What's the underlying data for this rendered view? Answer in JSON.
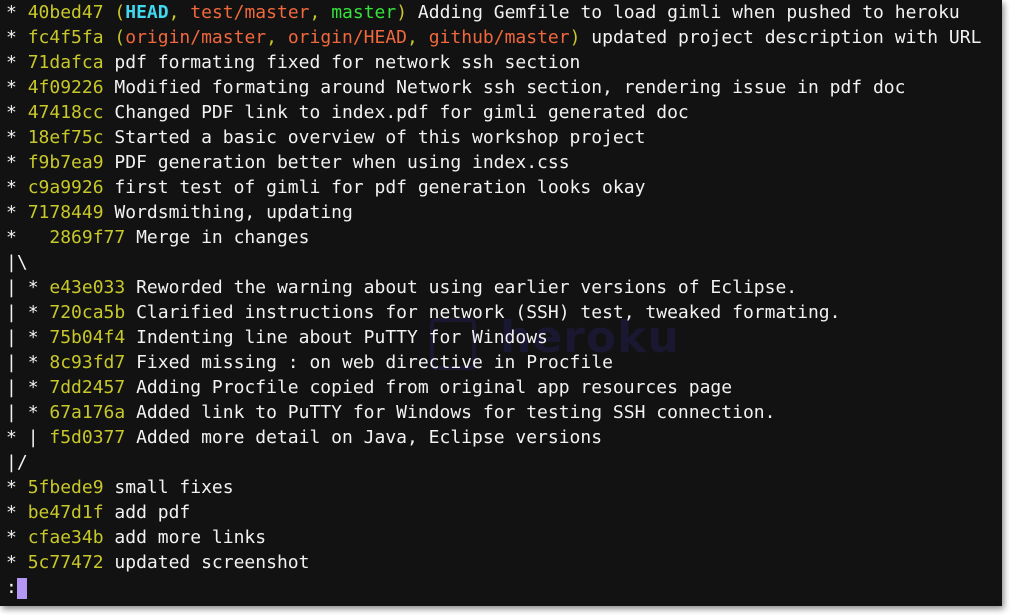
{
  "colors": {
    "background": "#121212",
    "hash": "#c8c82a",
    "head_ref": "#3fd8ef",
    "remote_ref": "#f0683c",
    "local_ref": "#34e23a",
    "branch_graph": "#2fd25a",
    "cursor": "#b497f5"
  },
  "watermark": {
    "text": "heroku"
  },
  "commits": [
    {
      "graph": "* ",
      "hash": "40bed47",
      "refs": [
        "HEAD",
        "test/master",
        "master"
      ],
      "message": "Adding Gemfile to load gimli when pushed to heroku"
    },
    {
      "graph": "* ",
      "hash": "fc4f5fa",
      "refs": [
        "origin/master",
        "origin/HEAD",
        "github/master"
      ],
      "message": "updated project description with URL"
    },
    {
      "graph": "* ",
      "hash": "71dafca",
      "message": "pdf formating fixed for network ssh section"
    },
    {
      "graph": "* ",
      "hash": "4f09226",
      "message": "Modified formating around Network ssh section, rendering issue in pdf doc"
    },
    {
      "graph": "* ",
      "hash": "47418cc",
      "message": "Changed PDF link to index.pdf for gimli generated doc"
    },
    {
      "graph": "* ",
      "hash": "18ef75c",
      "message": "Started a basic overview of this workshop project"
    },
    {
      "graph": "* ",
      "hash": "f9b7ea9",
      "message": "PDF generation better when using index.css"
    },
    {
      "graph": "* ",
      "hash": "c9a9926",
      "message": "first test of gimli for pdf generation looks okay"
    },
    {
      "graph": "* ",
      "hash": "7178449",
      "message": "Wordsmithing, updating"
    },
    {
      "graph": "*   ",
      "hash": "2869f77",
      "message": "Merge in changes"
    },
    {
      "graph_branch": "|\\"
    },
    {
      "graph_branch": "| ",
      "graph": "* ",
      "hash": "e43e033",
      "message": "Reworded the warning about using earlier versions of Eclipse."
    },
    {
      "graph_branch": "| ",
      "graph": "* ",
      "hash": "720ca5b",
      "message": "Clarified instructions for network (SSH) test, tweaked formating."
    },
    {
      "graph_branch": "| ",
      "graph": "* ",
      "hash": "75b04f4",
      "message": "Indenting line about PuTTY for Windows"
    },
    {
      "graph_branch": "| ",
      "graph": "* ",
      "hash": "8c93fd7",
      "message": "Fixed missing : on web directive in Procfile"
    },
    {
      "graph_branch": "| ",
      "graph": "* ",
      "hash": "7dd2457",
      "message": "Adding Procfile copied from original app resources page"
    },
    {
      "graph_branch": "| ",
      "graph": "* ",
      "hash": "67a176a",
      "message": "Added link to PuTTY for Windows for testing SSH connection."
    },
    {
      "graph": "* ",
      "graph_branch2": "| ",
      "hash": "f5d0377",
      "message": "Added more detail on Java, Eclipse versions"
    },
    {
      "graph_branch": "|/"
    },
    {
      "graph": "* ",
      "hash": "5fbede9",
      "message": "small fixes"
    },
    {
      "graph": "* ",
      "hash": "be47d1f",
      "message": "add pdf"
    },
    {
      "graph": "* ",
      "hash": "cfae34b",
      "message": "add more links"
    },
    {
      "graph": "* ",
      "hash": "5c77472",
      "message": "updated screenshot"
    }
  ],
  "pager_prompt": ":"
}
